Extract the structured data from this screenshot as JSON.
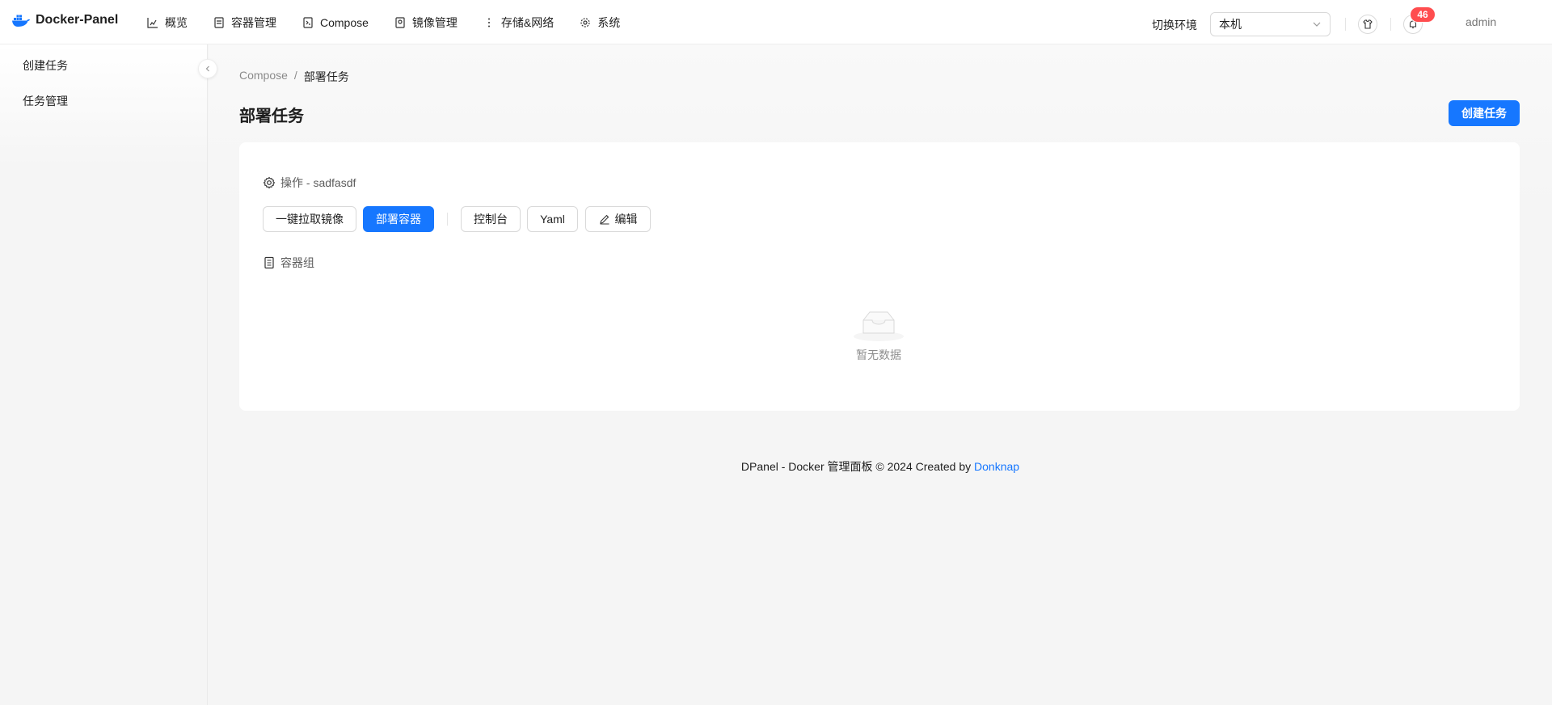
{
  "app": {
    "title": "Docker-Panel"
  },
  "nav": {
    "items": [
      {
        "label": "概览",
        "icon": "chart-icon"
      },
      {
        "label": "容器管理",
        "icon": "container-icon"
      },
      {
        "label": "Compose",
        "icon": "compose-icon"
      },
      {
        "label": "镜像管理",
        "icon": "image-icon"
      },
      {
        "label": "存储&网络",
        "icon": "storage-icon"
      },
      {
        "label": "系统",
        "icon": "gear-icon"
      }
    ]
  },
  "env": {
    "label": "切换环境",
    "selected": "本机"
  },
  "notifications": {
    "count": "46"
  },
  "user": {
    "name": "admin"
  },
  "sidebar": {
    "items": [
      {
        "label": "创建任务"
      },
      {
        "label": "任务管理"
      }
    ]
  },
  "breadcrumb": {
    "parent": "Compose",
    "separator": "/",
    "current": "部署任务"
  },
  "page": {
    "title": "部署任务",
    "create_button": "创建任务"
  },
  "operations": {
    "title": "操作 - sadfasdf",
    "buttons": {
      "pull": "一键拉取镜像",
      "deploy": "部署容器",
      "console": "控制台",
      "yaml": "Yaml",
      "edit": "编辑"
    }
  },
  "container_group": {
    "title": "容器组",
    "empty_text": "暂无数据"
  },
  "footer": {
    "text": "DPanel - Docker 管理面板 © 2024 Created by",
    "link": "Donknap"
  },
  "colors": {
    "primary": "#1677ff",
    "badge": "#ff4d4f"
  }
}
